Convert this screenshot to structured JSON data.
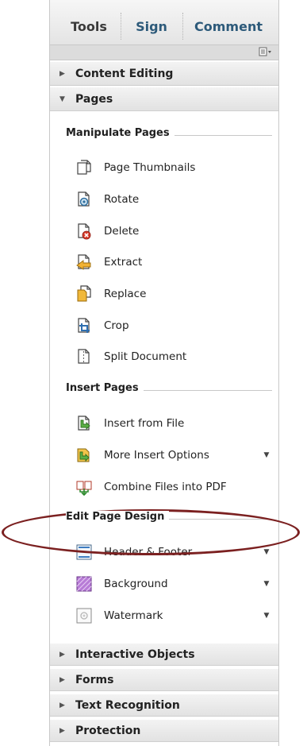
{
  "tabs": [
    {
      "label": "Tools"
    },
    {
      "label": "Sign"
    },
    {
      "label": "Comment"
    }
  ],
  "options_icon": "panel-options-icon",
  "sections": {
    "content_editing": {
      "label": "Content Editing",
      "state": "collapsed"
    },
    "pages": {
      "label": "Pages",
      "state": "expanded"
    },
    "interactive_objects": {
      "label": "Interactive Objects",
      "state": "collapsed"
    },
    "forms": {
      "label": "Forms",
      "state": "collapsed"
    },
    "text_recognition": {
      "label": "Text Recognition",
      "state": "collapsed"
    },
    "protection": {
      "label": "Protection",
      "state": "collapsed"
    }
  },
  "manipulate": {
    "title": "Manipulate Pages",
    "items": [
      {
        "label": "Page Thumbnails",
        "icon": "page-thumbnails-icon"
      },
      {
        "label": "Rotate",
        "icon": "rotate-icon"
      },
      {
        "label": "Delete",
        "icon": "delete-icon"
      },
      {
        "label": "Extract",
        "icon": "extract-icon"
      },
      {
        "label": "Replace",
        "icon": "replace-icon"
      },
      {
        "label": "Crop",
        "icon": "crop-icon"
      },
      {
        "label": "Split Document",
        "icon": "split-document-icon"
      }
    ]
  },
  "insert": {
    "title": "Insert Pages",
    "items": [
      {
        "label": "Insert from File",
        "icon": "insert-from-file-icon",
        "dropdown": false
      },
      {
        "label": "More Insert Options",
        "icon": "more-insert-options-icon",
        "dropdown": true
      },
      {
        "label": "Combine Files into PDF",
        "icon": "combine-files-icon",
        "dropdown": false
      }
    ]
  },
  "design": {
    "title": "Edit Page Design",
    "items": [
      {
        "label": "Header & Footer",
        "icon": "header-footer-icon",
        "dropdown": true
      },
      {
        "label": "Background",
        "icon": "background-icon",
        "dropdown": true
      },
      {
        "label": "Watermark",
        "icon": "watermark-icon",
        "dropdown": true
      }
    ]
  },
  "colors": {
    "tab_active": "#3a3a3a",
    "tab_link": "#2d5a7a",
    "highlight": "#7b2020"
  }
}
